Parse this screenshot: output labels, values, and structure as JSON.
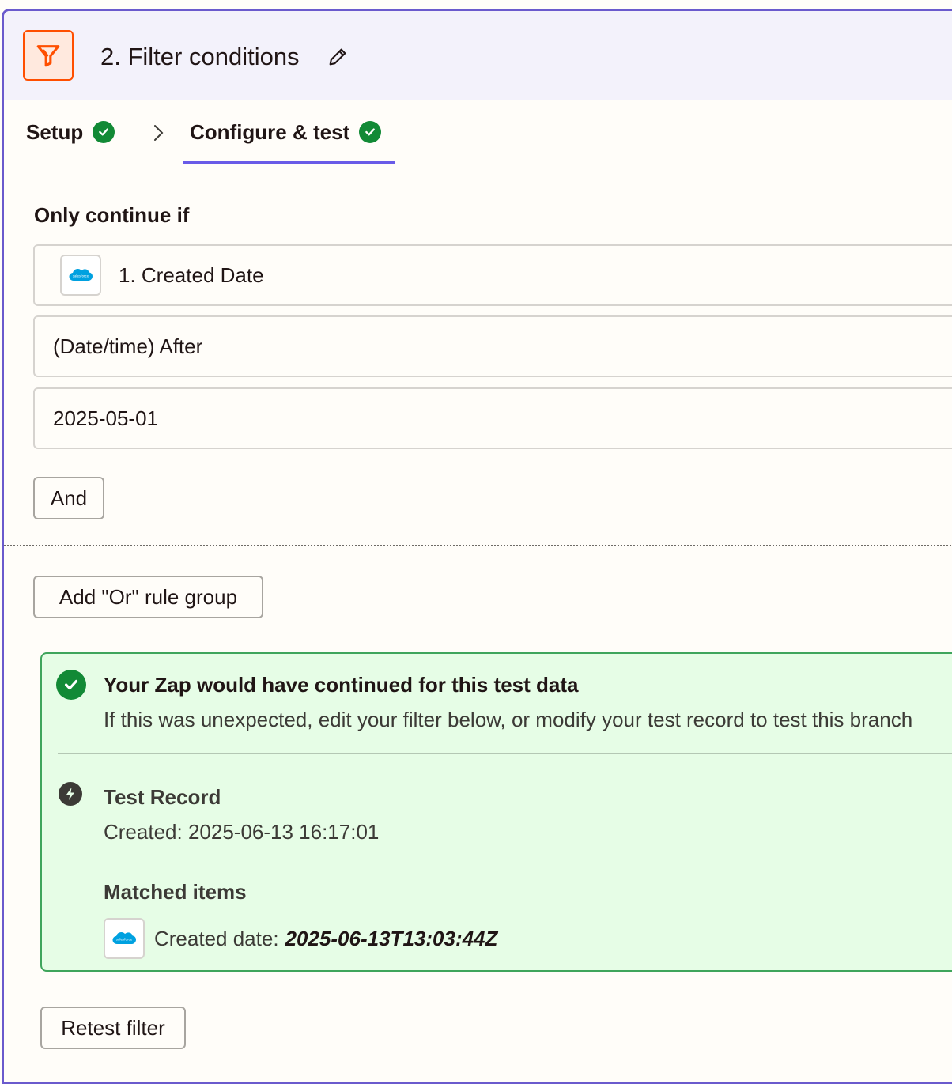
{
  "header": {
    "icon": "filter-icon",
    "title": "2. Filter conditions",
    "edit_icon": "pencil-icon",
    "accent": "#ff4f00"
  },
  "tabs": [
    {
      "label": "Setup",
      "status": "complete"
    },
    {
      "label": "Configure & test",
      "status": "complete",
      "active": true
    }
  ],
  "filter": {
    "section_label": "Only continue if",
    "field": {
      "app_icon": "salesforce-icon",
      "value": "1. Created Date"
    },
    "condition": "(Date/time) After",
    "value": "2025-05-01",
    "and_button": "And",
    "or_button": "Add \"Or\" rule group"
  },
  "result": {
    "title": "Your Zap would have continued for this test data",
    "description": "If this was unexpected, edit your filter below, or modify your test record to test this branch",
    "record_title": "Test Record",
    "record_created": "Created: 2025-06-13 16:17:01",
    "matched_title": "Matched items",
    "matched_label": "Created date:",
    "matched_value": "2025-06-13T13:03:44Z",
    "status_color": "#128a36",
    "background": "#e6fde6"
  },
  "actions": {
    "retest": "Retest filter"
  }
}
